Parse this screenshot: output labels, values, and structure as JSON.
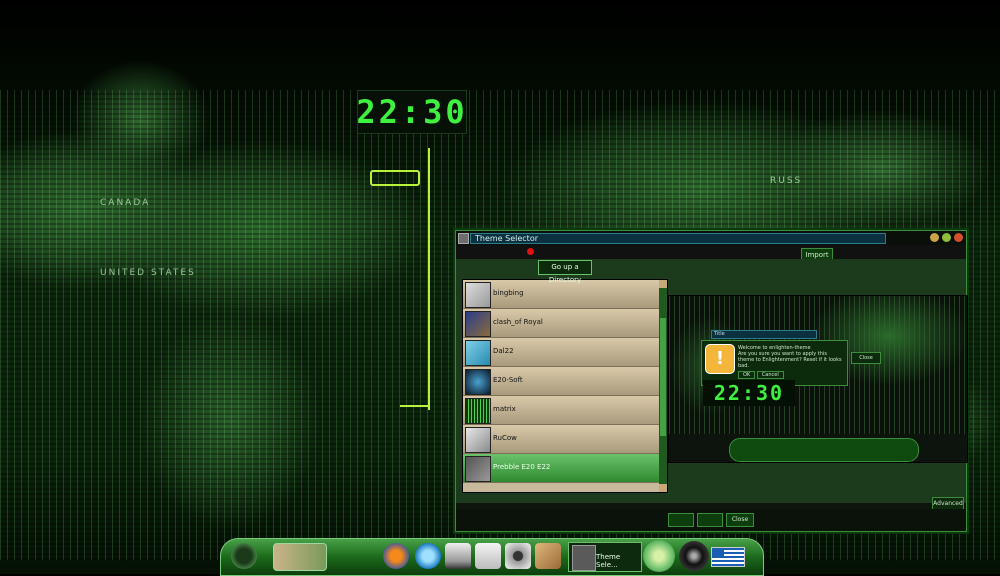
{
  "desktop": {
    "clock": "22:30",
    "map_labels": {
      "canada": "CANADA",
      "united_states": "UNITED STATES",
      "russia": "RUSS"
    }
  },
  "window": {
    "title": "Theme Selector",
    "buttons": {
      "import": "Import",
      "go_up_tooltip": "Go up a Directory",
      "advanced": "Advanced",
      "close": "Close"
    },
    "themes": [
      {
        "name": "bingbing",
        "selected": false
      },
      {
        "name": "clash_of Royal",
        "selected": false
      },
      {
        "name": "Dal22",
        "selected": false
      },
      {
        "name": "E20-Soft",
        "selected": false
      },
      {
        "name": "matrix",
        "selected": false
      },
      {
        "name": "RuCow",
        "selected": false
      },
      {
        "name": "Prebble E20 E22",
        "selected": true
      }
    ],
    "preview": {
      "dialog_title": "Title",
      "dialog_heading": "Welcome to enlighten-theme",
      "dialog_message": "Are you sure you want to apply this theme to Enlightenment? Reset if it looks bad.",
      "ok": "OK",
      "cancel": "Cancel",
      "close": "Close",
      "clock": "22:30"
    }
  },
  "dock": {
    "task_label": "Theme Sele...",
    "icons": [
      "pager-icon",
      "firefox-icon",
      "browser-icon",
      "terminal-icon",
      "files-icon",
      "disk-icon",
      "package-icon",
      "clock-icon",
      "compass-icon",
      "greece-flag-icon"
    ]
  }
}
